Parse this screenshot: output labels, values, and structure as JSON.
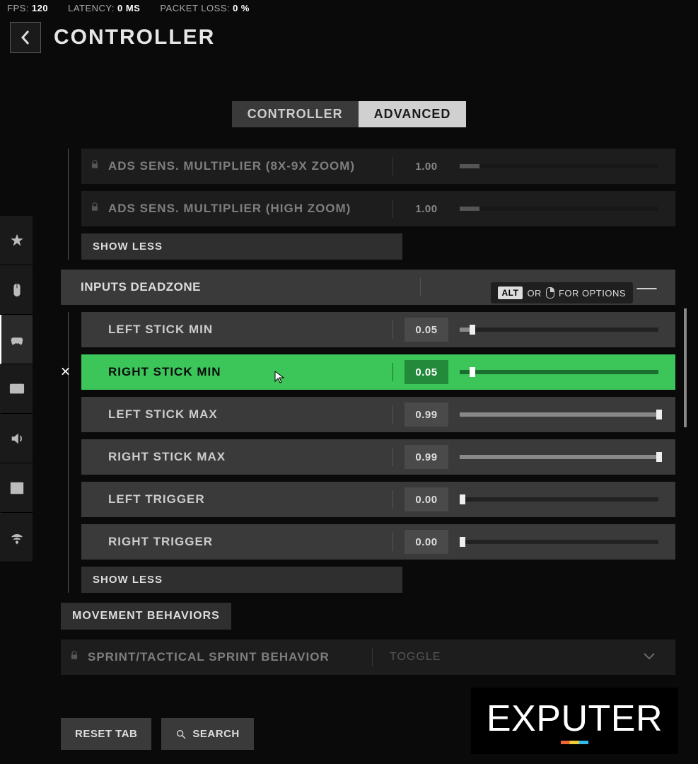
{
  "stats": {
    "fps_label": "FPS:",
    "fps": "120",
    "lat_label": "LATENCY:",
    "lat": "0 MS",
    "loss_label": "PACKET LOSS:",
    "loss": "0 %"
  },
  "header": {
    "title": "CONTROLLER"
  },
  "tabs": {
    "controller": "CONTROLLER",
    "advanced": "ADVANCED"
  },
  "rows": {
    "ads8x": {
      "label": "ADS SENS. MULTIPLIER (8X-9X ZOOM)",
      "val": "1.00"
    },
    "adshigh": {
      "label": "ADS SENS. MULTIPLIER (HIGH ZOOM)",
      "val": "1.00"
    },
    "showless1": "SHOW LESS",
    "section": "INPUTS DEADZONE",
    "lsmin": {
      "label": "LEFT STICK MIN",
      "val": "0.05"
    },
    "rsmin": {
      "label": "RIGHT STICK MIN",
      "val": "0.05"
    },
    "lsmax": {
      "label": "LEFT STICK MAX",
      "val": "0.99"
    },
    "rsmax": {
      "label": "RIGHT STICK MAX",
      "val": "0.99"
    },
    "ltrig": {
      "label": "LEFT TRIGGER",
      "val": "0.00"
    },
    "rtrig": {
      "label": "RIGHT TRIGGER",
      "val": "0.00"
    },
    "showless2": "SHOW LESS",
    "movhdr": "MOVEMENT BEHAVIORS",
    "sprint": {
      "label": "SPRINT/TACTICAL SPRINT BEHAVIOR",
      "val": "TOGGLE"
    }
  },
  "tooltip": {
    "alt": "ALT",
    "or": "or",
    "text": "for options"
  },
  "footer": {
    "reset": "RESET TAB",
    "search": "SEARCH"
  },
  "logo": {
    "pre": "exp",
    "u": "u",
    "post": "ter"
  }
}
